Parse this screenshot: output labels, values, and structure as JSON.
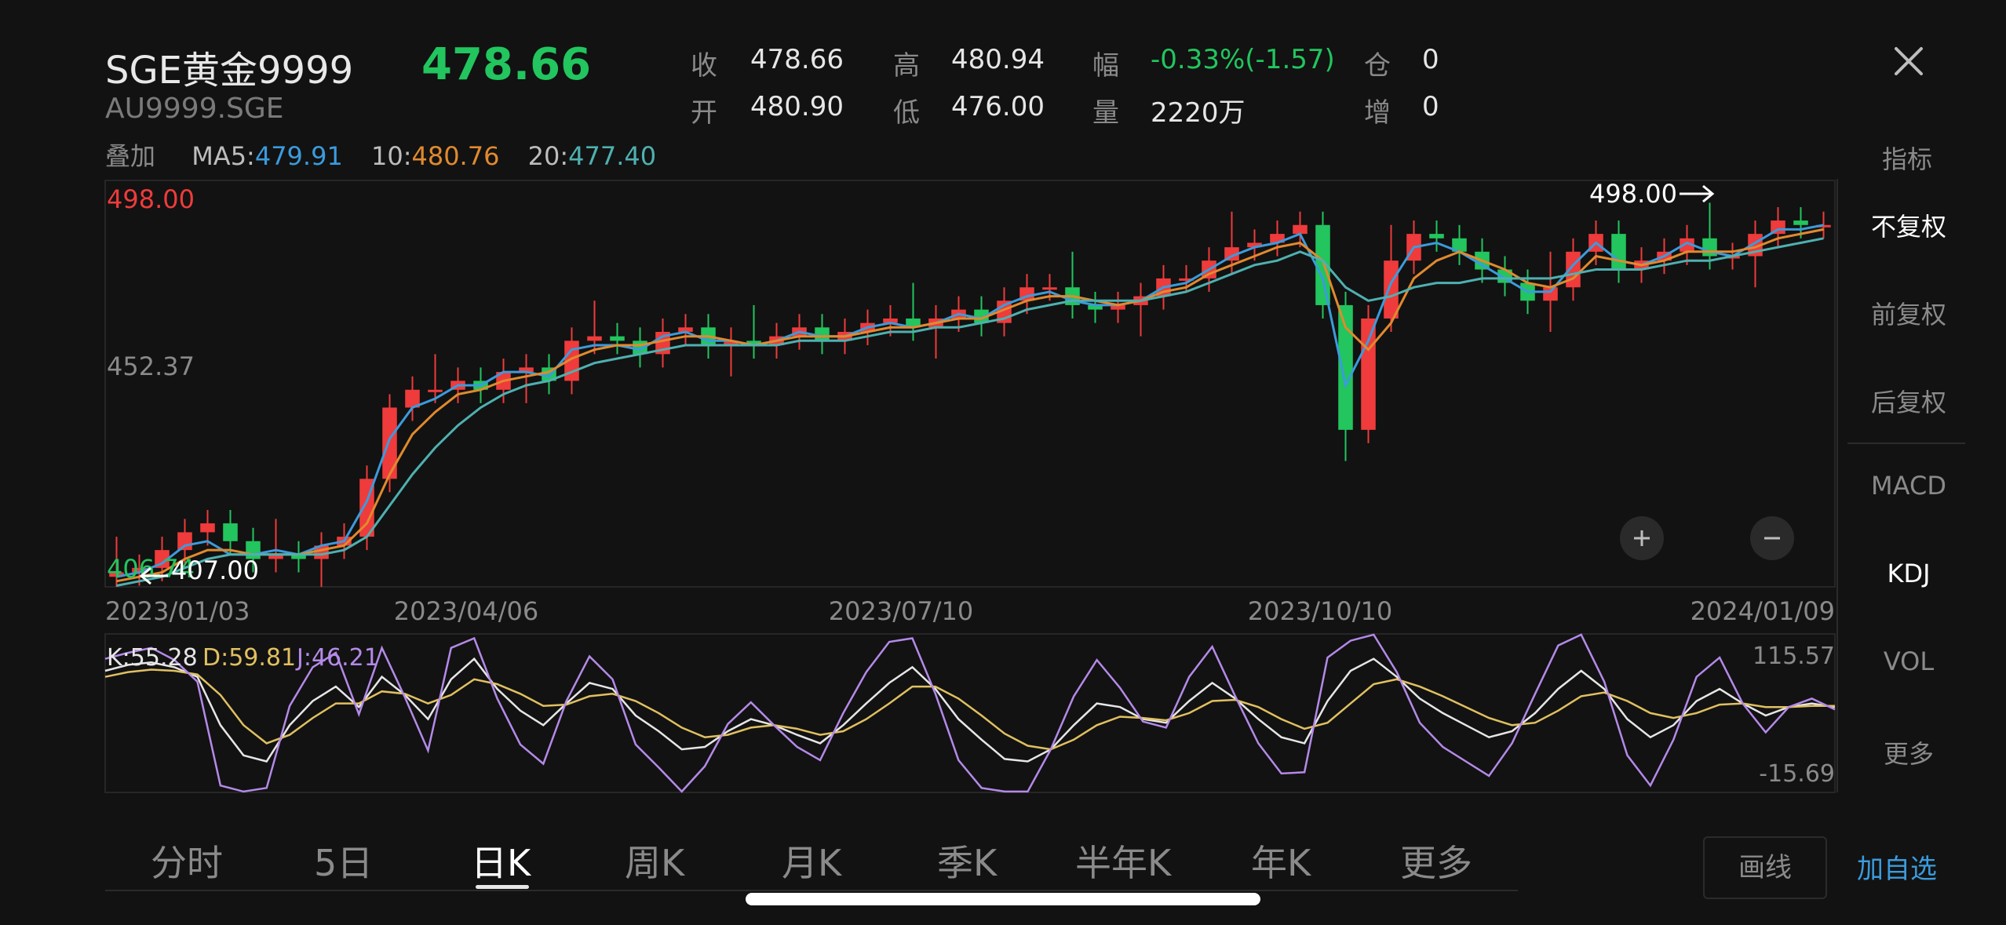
{
  "header": {
    "name": "SGE黄金9999",
    "code": "AU9999.SGE",
    "price": "478.66",
    "stats": [
      {
        "label": "收",
        "value": "478.66",
        "color": "#e6e6e6"
      },
      {
        "label": "高",
        "value": "480.94",
        "color": "#e6e6e6"
      },
      {
        "label": "幅",
        "value": "-0.33%(-1.57)",
        "color": "#22c55e"
      },
      {
        "label": "仓",
        "value": "0",
        "color": "#e6e6e6"
      },
      {
        "label": "开",
        "value": "480.90",
        "color": "#e6e6e6"
      },
      {
        "label": "低",
        "value": "476.00",
        "color": "#e6e6e6"
      },
      {
        "label": "量",
        "value": "2220万",
        "color": "#e6e6e6"
      },
      {
        "label": "增",
        "value": "0",
        "color": "#e6e6e6"
      }
    ]
  },
  "overlay": {
    "label": "叠加",
    "ma5_label": "MA5",
    "ma5": "479.91",
    "ma10_label": "10",
    "ma10": "480.76",
    "ma20_label": "20",
    "ma20": "477.40"
  },
  "indicator_button": "指标",
  "side_menu": [
    {
      "label": "不复权",
      "active": true
    },
    {
      "label": "前复权",
      "active": false
    },
    {
      "label": "后复权",
      "active": false
    },
    {
      "label": "MACD",
      "active": false
    },
    {
      "label": "KDJ",
      "active": true
    },
    {
      "label": "VOL",
      "active": false
    },
    {
      "label": "更多",
      "active": false
    }
  ],
  "tabs": [
    {
      "label": "分时",
      "active": false
    },
    {
      "label": "5日",
      "active": false
    },
    {
      "label": "日K",
      "active": true
    },
    {
      "label": "周K",
      "active": false
    },
    {
      "label": "月K",
      "active": false
    },
    {
      "label": "季K",
      "active": false
    },
    {
      "label": "半年K",
      "active": false
    },
    {
      "label": "年K",
      "active": false
    },
    {
      "label": "更多",
      "active": false
    }
  ],
  "buttons": {
    "draw": "画线",
    "add_watch": "加自选"
  },
  "colors": {
    "up": "#ef3b3b",
    "down": "#22c55e",
    "ma5": "#3b9bdc",
    "ma10": "#e08a2e",
    "ma20": "#4fb0b0",
    "k": "#e6e6e6",
    "d": "#e0c060",
    "j": "#b48ae8"
  },
  "chart_data": [
    {
      "type": "candlestick",
      "x_ticks": [
        "2023/01/03",
        "2023/04/06",
        "2023/07/10",
        "2023/10/10",
        "2024/01/09"
      ],
      "y_labels": {
        "top": "498.00",
        "mid": "452.37",
        "bottom": "406.74"
      },
      "ylim": [
        406.74,
        498.0
      ],
      "annotations": {
        "max": "498.00",
        "min": "407.00"
      },
      "series": [
        {
          "name": "MA5",
          "values": [
            409,
            410,
            412,
            416,
            417,
            414,
            414,
            415,
            414,
            416,
            417,
            426,
            440,
            447,
            449,
            452,
            452,
            455,
            455,
            454,
            460,
            461,
            461,
            460,
            463,
            464,
            462,
            462,
            461,
            462,
            464,
            463,
            463,
            465,
            466,
            465,
            466,
            468,
            467,
            470,
            472,
            473,
            471,
            470,
            470,
            471,
            474,
            475,
            478,
            481,
            483,
            484,
            486,
            476,
            452,
            462,
            475,
            483,
            484,
            482,
            479,
            476,
            473,
            473,
            479,
            484,
            480,
            479,
            481,
            484,
            482,
            481,
            484,
            487,
            487,
            488
          ]
        },
        {
          "name": "10",
          "values": [
            408,
            409,
            410,
            413,
            415,
            415,
            414,
            414,
            414,
            415,
            416,
            421,
            432,
            441,
            446,
            450,
            451,
            453,
            454,
            455,
            458,
            460,
            461,
            461,
            462,
            463,
            463,
            462,
            461,
            462,
            463,
            463,
            463,
            464,
            465,
            465,
            466,
            467,
            467,
            469,
            471,
            472,
            472,
            471,
            470,
            471,
            473,
            474,
            477,
            479,
            481,
            483,
            484,
            480,
            465,
            460,
            466,
            476,
            480,
            482,
            480,
            478,
            475,
            474,
            476,
            481,
            480,
            479,
            480,
            482,
            482,
            482,
            483,
            485,
            486,
            487
          ]
        },
        {
          "name": "20",
          "values": [
            407,
            408,
            409,
            411,
            413,
            414,
            414,
            414,
            414,
            414,
            415,
            418,
            425,
            432,
            438,
            443,
            447,
            450,
            452,
            453,
            455,
            457,
            458,
            459,
            460,
            461,
            461,
            461,
            461,
            461,
            462,
            462,
            462,
            463,
            464,
            464,
            465,
            465,
            466,
            467,
            469,
            470,
            471,
            471,
            471,
            471,
            472,
            473,
            475,
            477,
            479,
            480,
            482,
            480,
            474,
            471,
            472,
            474,
            475,
            475,
            476,
            476,
            476,
            476,
            477,
            478,
            478,
            478,
            479,
            480,
            480,
            481,
            482,
            483,
            484,
            485
          ]
        }
      ],
      "candles": [
        410,
        411,
        415,
        419,
        421,
        417,
        413,
        414,
        413,
        416,
        418,
        431,
        447,
        451,
        451,
        453,
        451,
        455,
        456,
        453,
        462,
        463,
        462,
        459,
        464,
        465,
        461,
        462,
        461,
        463,
        465,
        462,
        464,
        466,
        467,
        465,
        467,
        469,
        466,
        471,
        474,
        474,
        470,
        469,
        470,
        472,
        476,
        476,
        480,
        483,
        484,
        486,
        488,
        470,
        442,
        467,
        480,
        486,
        485,
        482,
        478,
        475,
        471,
        474,
        482,
        486,
        478,
        480,
        482,
        485,
        481,
        481,
        486,
        489,
        488,
        488
      ]
    },
    {
      "type": "line",
      "name": "KDJ",
      "legend": {
        "K": "55.28",
        "D": "59.81",
        "J": "46.21"
      },
      "ylim": [
        -15.69,
        115.57
      ],
      "y_labels": {
        "top": "115.57",
        "bottom": "-15.69"
      },
      "series": [
        {
          "name": "K",
          "values": [
            85,
            90,
            92,
            88,
            80,
            40,
            15,
            10,
            40,
            60,
            72,
            55,
            80,
            65,
            45,
            78,
            95,
            70,
            52,
            40,
            58,
            75,
            70,
            48,
            35,
            20,
            22,
            35,
            45,
            40,
            32,
            25,
            40,
            58,
            75,
            88,
            70,
            45,
            28,
            12,
            10,
            20,
            40,
            58,
            55,
            45,
            42,
            60,
            75,
            62,
            45,
            30,
            25,
            60,
            85,
            95,
            80,
            62,
            50,
            40,
            30,
            35,
            50,
            70,
            85,
            70,
            45,
            30,
            40,
            60,
            70,
            58,
            48,
            55,
            58,
            55
          ]
        },
        {
          "name": "D",
          "values": [
            80,
            84,
            86,
            85,
            82,
            65,
            40,
            25,
            32,
            46,
            58,
            58,
            68,
            66,
            58,
            65,
            78,
            74,
            66,
            56,
            57,
            64,
            66,
            60,
            50,
            38,
            30,
            32,
            38,
            40,
            37,
            32,
            35,
            45,
            58,
            72,
            72,
            62,
            48,
            33,
            23,
            20,
            28,
            40,
            47,
            46,
            44,
            50,
            60,
            61,
            55,
            45,
            37,
            42,
            58,
            74,
            78,
            72,
            64,
            55,
            46,
            40,
            42,
            52,
            64,
            67,
            60,
            50,
            46,
            50,
            57,
            58,
            55,
            55,
            56,
            56
          ]
        },
        {
          "name": "J",
          "values": [
            95,
            100,
            104,
            94,
            76,
            -10,
            -15,
            -12,
            56,
            88,
            100,
            49,
            104,
            63,
            19,
            104,
            112,
            62,
            24,
            8,
            60,
            97,
            78,
            24,
            5,
            -15,
            6,
            41,
            59,
            40,
            22,
            11,
            50,
            84,
            109,
            112,
            66,
            11,
            -12,
            -15,
            -15,
            20,
            64,
            94,
            71,
            43,
            38,
            80,
            105,
            64,
            25,
            0,
            1,
            96,
            110,
            115,
            84,
            42,
            22,
            10,
            -2,
            25,
            66,
            106,
            115,
            76,
            15,
            -10,
            28,
            80,
            96,
            58,
            34,
            55,
            62,
            53
          ]
        }
      ]
    }
  ]
}
